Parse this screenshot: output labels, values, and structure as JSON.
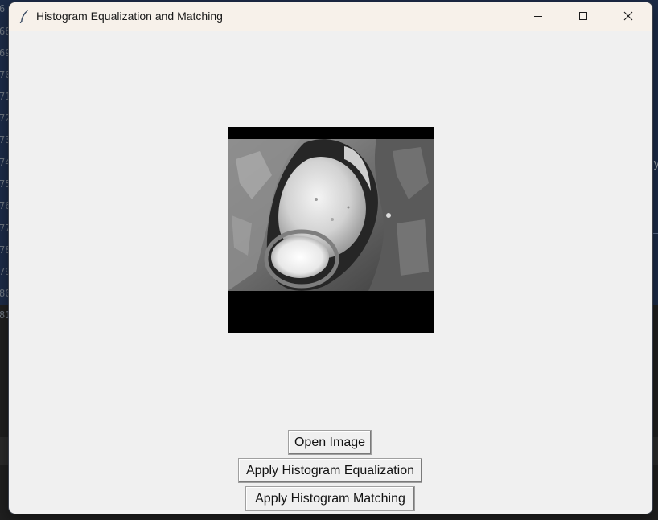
{
  "window": {
    "title": "Histogram Equalization and Matching",
    "icon": "feather-icon",
    "controls": [
      "minimize-icon",
      "maximize-icon",
      "close-icon"
    ]
  },
  "buttons": {
    "open_image": "Open Image",
    "apply_equalization": "Apply Histogram Equalization",
    "apply_matching": "Apply Histogram Matching"
  },
  "background_editor": {
    "line_numbers": [
      "6",
      "68",
      "69",
      "70",
      "71",
      "72",
      "73",
      "74",
      "75",
      "76",
      "77",
      "78",
      "79",
      "80",
      "81"
    ],
    "right_fragment": "y"
  },
  "colors": {
    "window_bg": "#f0f0f0",
    "titlebar_bg": "#f7f1ea",
    "image_bg": "#000000"
  }
}
